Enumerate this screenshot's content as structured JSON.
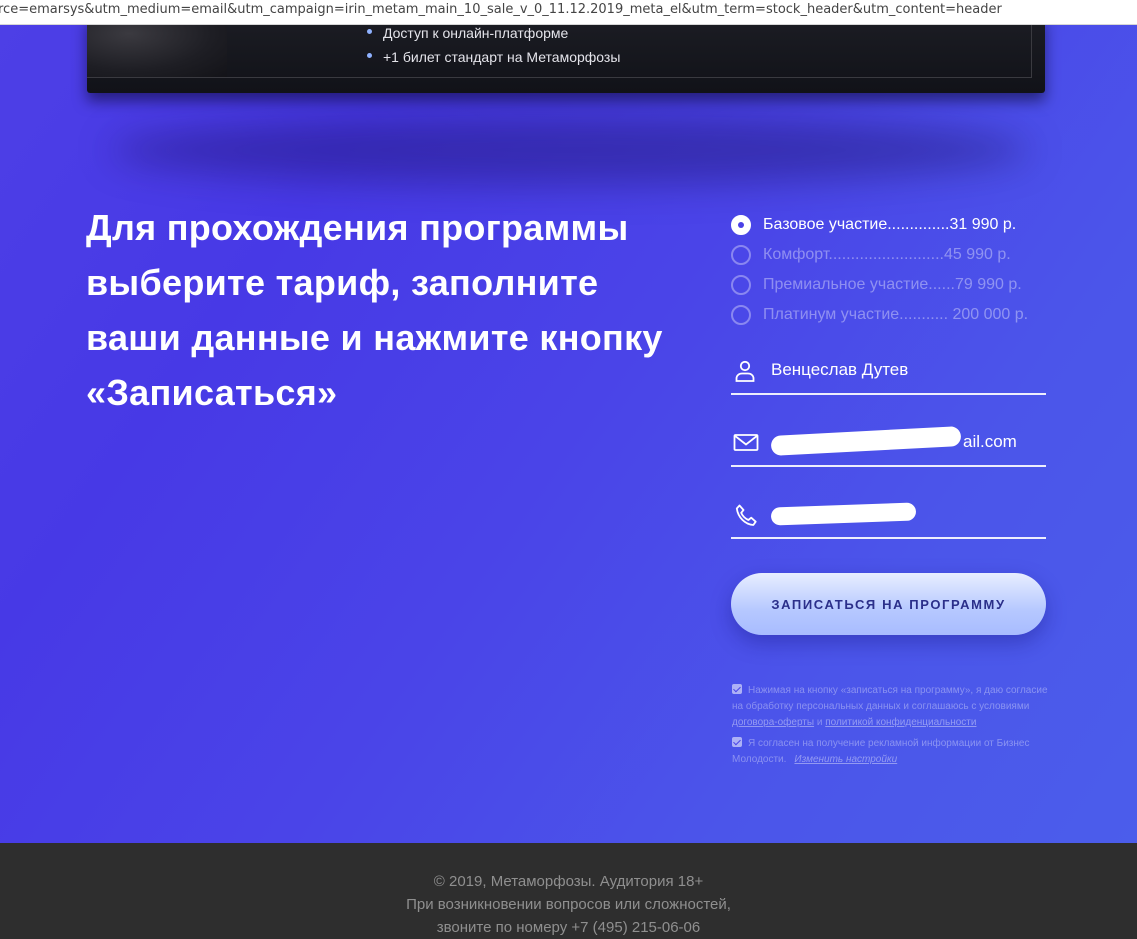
{
  "browser": {
    "url": "rce=emarsys&utm_medium=email&utm_campaign=irin_metam_main_10_sale_v_0_11.12.2019_meta_el&utm_term=stock_header&utm_content=header"
  },
  "card": {
    "bullets": [
      "Доступ к онлайн-платформе",
      "+1 билет стандарт на Метаморфозы"
    ]
  },
  "headline": "Для прохождения программы выберите тариф, заполните ваши данные и нажмите кнопку «Записаться»",
  "tariffs": [
    {
      "label": "Базовое участие..............31 990 р.",
      "selected": true
    },
    {
      "label": "Комфорт..........................45 990 р.",
      "selected": false
    },
    {
      "label": "Премиальное участие......79 990 р.",
      "selected": false
    },
    {
      "label": "Платинум участие........... 200 000 р.",
      "selected": false
    }
  ],
  "form": {
    "name_value": "Венцеслав Дутев",
    "email_value": "ail.com",
    "phone_value": "",
    "submit_label": "ЗАПИСАТЬСЯ НА ПРОГРАММУ"
  },
  "consent": {
    "text1": "Нажимая на кнопку «записаться на программу», я даю согласие на обработку персональных данных и соглашаюсь с условиями",
    "link_offer": "договора-оферты",
    "and": "и",
    "link_privacy": "политикой конфиденциальности",
    "text2": "Я согласен на получение рекламной информации от Бизнес Молодости.",
    "link_settings": "Изменить настройки"
  },
  "footer": {
    "line1": "© 2019, Метаморфозы. Аудитория 18+",
    "line2": "При возникновении вопросов или сложностей,",
    "line3": "звоните по номеру +7 (495) 215-06-06"
  },
  "colors": {
    "bg_start": "#4d3fe6",
    "bg_end": "#4b5deb",
    "footer_bg": "#2e2e2e",
    "button_text": "#2b2f8a"
  },
  "icons": [
    "user-icon",
    "mail-icon",
    "phone-icon"
  ]
}
